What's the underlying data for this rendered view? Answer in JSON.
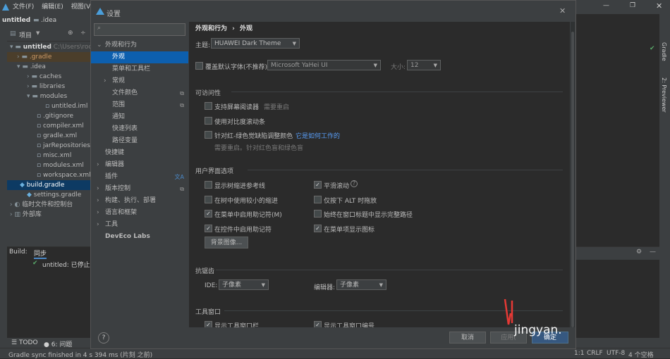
{
  "ide": {
    "menu": [
      "文件(F)",
      "编辑(E)",
      "视图(V)"
    ],
    "project_name": "untitled",
    "project_folder": ".idea",
    "project_tab": "项目",
    "tree": [
      {
        "label": "untitled",
        "suffix": "C:\\Users\\roo",
        "kind": "root"
      },
      {
        "label": ".gradle",
        "kind": "folder"
      },
      {
        "label": ".idea",
        "kind": "folder"
      },
      {
        "label": "caches",
        "kind": "folder"
      },
      {
        "label": "libraries",
        "kind": "folder"
      },
      {
        "label": "modules",
        "kind": "folder"
      },
      {
        "label": "untitled.iml",
        "kind": "file"
      },
      {
        "label": ".gitignore",
        "kind": "file"
      },
      {
        "label": "compiler.xml",
        "kind": "file"
      },
      {
        "label": "gradle.xml",
        "kind": "file"
      },
      {
        "label": "jarRepositories.",
        "kind": "file"
      },
      {
        "label": "misc.xml",
        "kind": "file"
      },
      {
        "label": "modules.xml",
        "kind": "file"
      },
      {
        "label": "workspace.xml",
        "kind": "file"
      },
      {
        "label": "build.gradle",
        "kind": "file"
      },
      {
        "label": "settings.gradle",
        "kind": "file"
      },
      {
        "label": "临时文件和控制台",
        "kind": "folder"
      },
      {
        "label": "外部库",
        "kind": "folder"
      }
    ],
    "build_label": "Build:",
    "build_tab": "同步",
    "build_status": "untitled: 已停止",
    "bottom_tabs": [
      "TODO",
      "6: 问题"
    ],
    "status_text": "Gradle sync finished in 4 s 394 ms (片刻 之前)",
    "status_right": [
      "1:1",
      "CRLF",
      "UTF-8",
      "4 个空格"
    ],
    "right_stripe": [
      "Gradle",
      "2: Previewer"
    ]
  },
  "dialog": {
    "title": "设置",
    "search_placeholder": "",
    "sidebar": [
      {
        "label": "外观和行为",
        "level": 0,
        "expanded": true
      },
      {
        "label": "外观",
        "level": 1,
        "selected": true
      },
      {
        "label": "菜单和工具栏",
        "level": 1
      },
      {
        "label": "常规",
        "level": 1,
        "collapsible": true
      },
      {
        "label": "文件颜色",
        "level": 1,
        "aux": "⧉"
      },
      {
        "label": "范围",
        "level": 1,
        "aux": "⧉"
      },
      {
        "label": "通知",
        "level": 1
      },
      {
        "label": "快速列表",
        "level": 1
      },
      {
        "label": "路径变量",
        "level": 1
      },
      {
        "label": "快捷键",
        "level": 0
      },
      {
        "label": "编辑器",
        "level": 0,
        "collapsible": true
      },
      {
        "label": "插件",
        "level": 0,
        "aux": "文A"
      },
      {
        "label": "版本控制",
        "level": 0,
        "collapsible": true,
        "aux": "⧉"
      },
      {
        "label": "构建、执行、部署",
        "level": 0,
        "collapsible": true
      },
      {
        "label": "语言和框架",
        "level": 0,
        "collapsible": true
      },
      {
        "label": "工具",
        "level": 0,
        "collapsible": true
      },
      {
        "label": "DevEco Labs",
        "level": 0
      }
    ],
    "breadcrumb": [
      "外观和行为",
      "外观"
    ],
    "theme_label": "主题:",
    "theme_value": "HUAWEI Dark Theme",
    "font_override_label": "覆盖默认字体(不推荐):",
    "font_value": "Microsoft YaHei UI",
    "size_label": "大小:",
    "size_value": "12",
    "accessibility": {
      "heading": "可访问性",
      "screen_reader": "支持屏幕阅读器",
      "screen_reader_hint": "需要重启",
      "contrast_scrollbars": "使用对比度滚动条",
      "color_blind": "针对红-绿色觉缺陷调整颜色",
      "color_blind_link": "它是如何工作的",
      "color_blind_hint": "需要重启。针对红色盲和绿色盲"
    },
    "ui_options": {
      "heading": "用户界面选项",
      "items_left": [
        {
          "label": "显示树缩进参考线",
          "checked": false
        },
        {
          "label": "在树中使用较小的缩进",
          "checked": false
        },
        {
          "label": "在菜单中启用助记符(M)",
          "checked": true
        },
        {
          "label": "在控件中启用助记符",
          "checked": true
        }
      ],
      "items_right": [
        {
          "label": "平滑滚动",
          "checked": true
        },
        {
          "label": "仅按下 ALT 时拖放",
          "checked": false
        },
        {
          "label": "始终在窗口标题中显示完整路径",
          "checked": false
        },
        {
          "label": "在菜单项显示图标",
          "checked": true
        }
      ],
      "background_button": "背景图像..."
    },
    "antialias": {
      "heading": "抗锯齿",
      "ide_label": "IDE:",
      "ide_value": "子像素",
      "editor_label": "编辑器:",
      "editor_value": "子像素"
    },
    "tool_windows": {
      "heading": "工具窗口",
      "show_bars": "显示工具窗口栏",
      "show_numbers": "显示工具窗口编号"
    },
    "footer": {
      "help": "?",
      "cancel": "取消",
      "apply": "应用(",
      "ok": "确定"
    },
    "watermark": "jingyan."
  }
}
